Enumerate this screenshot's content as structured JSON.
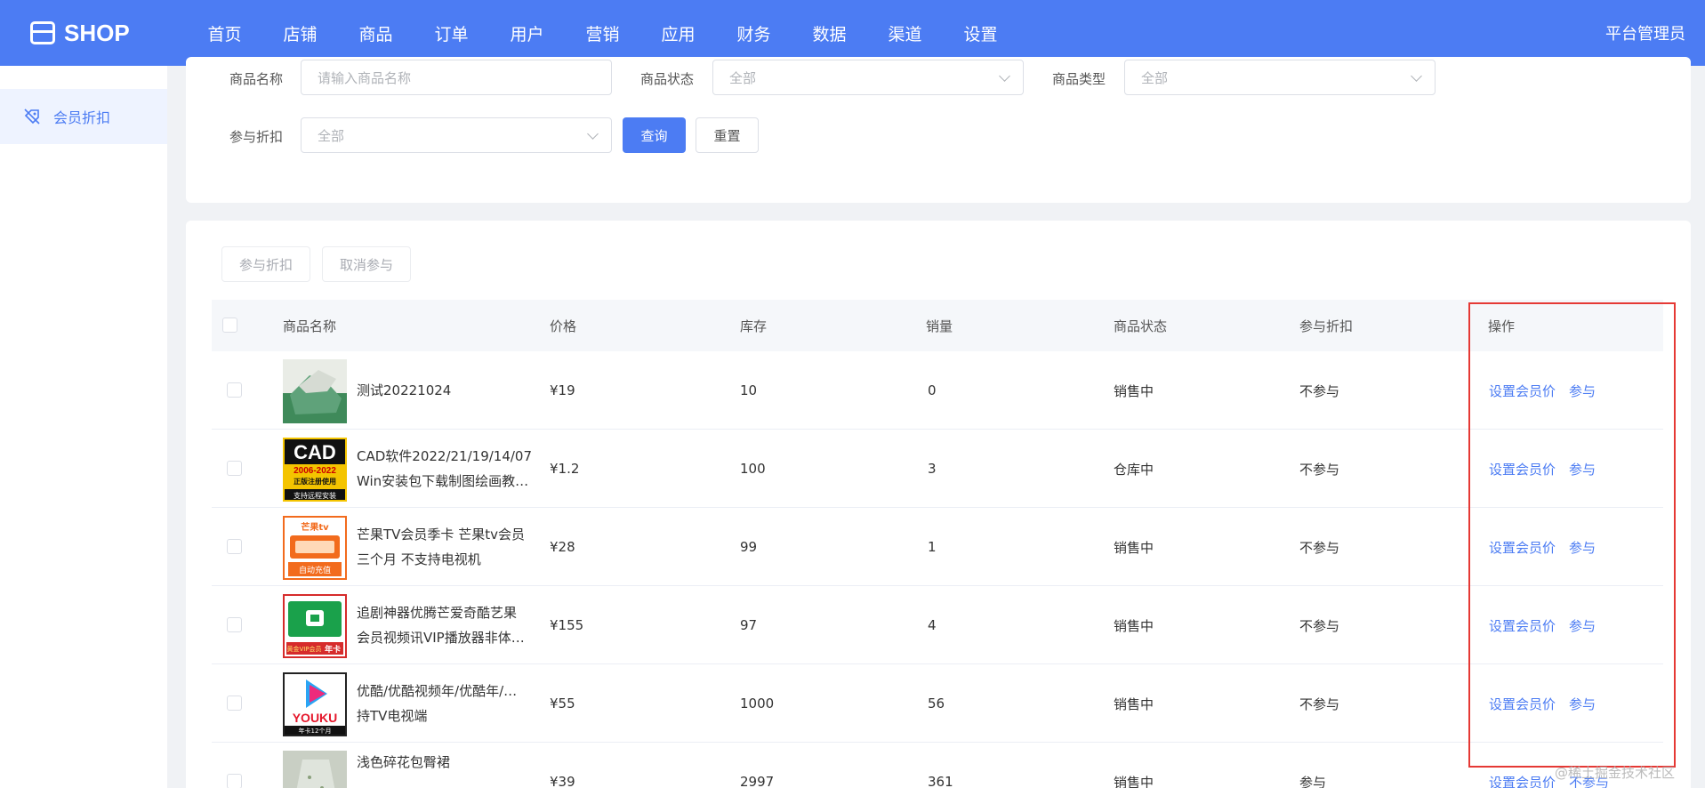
{
  "header": {
    "logo_text": "SHOP",
    "nav": [
      "首页",
      "店铺",
      "商品",
      "订单",
      "用户",
      "营销",
      "应用",
      "财务",
      "数据",
      "渠道",
      "设置"
    ],
    "active_nav": "营销",
    "admin_label": "平台管理员"
  },
  "sidebar": {
    "items": [
      {
        "label": "会员折扣",
        "icon": "discount-icon"
      }
    ]
  },
  "filters": {
    "name_label": "商品名称",
    "name_placeholder": "请输入商品名称",
    "status_label": "商品状态",
    "status_value": "全部",
    "type_label": "商品类型",
    "type_value": "全部",
    "discount_label": "参与折扣",
    "discount_value": "全部",
    "query_button": "查询",
    "reset_button": "重置"
  },
  "toolbar": {
    "join_button": "参与折扣",
    "cancel_button": "取消参与"
  },
  "table": {
    "columns": [
      "商品名称",
      "价格",
      "库存",
      "销量",
      "商品状态",
      "参与折扣",
      "操作"
    ],
    "rows": [
      {
        "name_line1": "测试20221024",
        "name_line2": "",
        "price": "¥19",
        "stock": "10",
        "sales": "0",
        "status": "销售中",
        "discount": "不参与",
        "action_set": "设置会员价",
        "action_join": "参与",
        "thumb": "green-shirt"
      },
      {
        "name_line1": "CAD软件2022/21/19/14/07",
        "name_line2": "Win安装包下载制图绘画教…",
        "price": "¥1.2",
        "stock": "100",
        "sales": "3",
        "status": "仓库中",
        "discount": "不参与",
        "action_set": "设置会员价",
        "action_join": "参与",
        "thumb": "cad"
      },
      {
        "name_line1": "芒果TV会员季卡 芒果tv会员",
        "name_line2": "三个月 不支持电视机",
        "price": "¥28",
        "stock": "99",
        "sales": "1",
        "status": "销售中",
        "discount": "不参与",
        "action_set": "设置会员价",
        "action_join": "参与",
        "thumb": "mango"
      },
      {
        "name_line1": "追剧神器优腾芒爱奇酷艺果",
        "name_line2": "会员视频讯VIP播放器非体…",
        "price": "¥155",
        "stock": "97",
        "sales": "4",
        "status": "销售中",
        "discount": "不参与",
        "action_set": "设置会员价",
        "action_join": "参与",
        "thumb": "vip"
      },
      {
        "name_line1": "优酷/优酷视频年/优酷年/…",
        "name_line2": "持TV电视端",
        "price": "¥55",
        "stock": "1000",
        "sales": "56",
        "status": "销售中",
        "discount": "不参与",
        "action_set": "设置会员价",
        "action_join": "参与",
        "thumb": "youku"
      },
      {
        "name_line1": "浅色碎花包臀裙",
        "name_line2": "",
        "price": "¥39",
        "stock": "2997",
        "sales": "361",
        "status": "销售中",
        "discount": "参与",
        "action_set": "设置会员价",
        "action_join": "不参与",
        "thumb": "skirt"
      }
    ]
  },
  "thumb_text": {
    "cad_top": "CAD",
    "cad_mid": "2006-2022",
    "cad_reg": "正版注册使用",
    "cad_bottom": "支持远程安装",
    "mango_brand": "芒果tv",
    "mango_label": "自动充值",
    "vip_label": "黄金VIP会员",
    "vip_card": "年卡",
    "youku_brand": "YOUKU",
    "youku_sub": "年卡12个月"
  },
  "watermark": "@稀土掘金技术社区",
  "colors": {
    "primary": "#4c7cf3",
    "highlight": "#e53935"
  }
}
